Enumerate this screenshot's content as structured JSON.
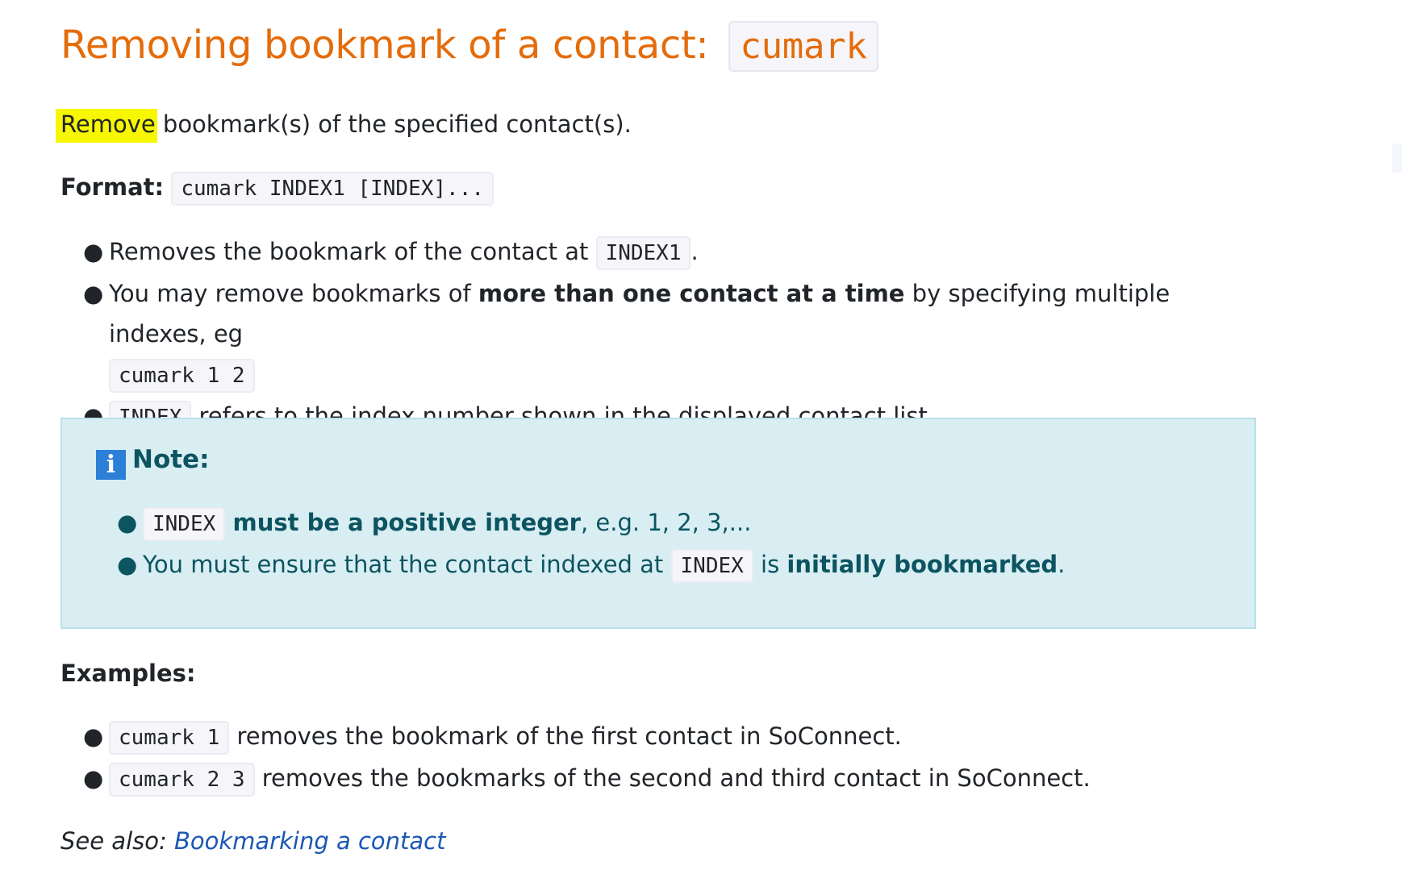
{
  "title": {
    "text": "Removing bookmark of a contact:",
    "command": "cumark"
  },
  "intro": {
    "highlighted": "Remove",
    "rest": " bookmark(s) of the specified contact(s)."
  },
  "format": {
    "label": "Format:",
    "code": "cumark INDEX1 [INDEX]..."
  },
  "usage": [
    {
      "before": "Removes the bookmark of the contact at ",
      "code": "INDEX1",
      "after": "."
    },
    {
      "before": "You may remove bookmarks of ",
      "bold": "more than one contact at a time",
      "after": " by specifying multiple indexes, eg",
      "code": "cumark 1 2"
    },
    {
      "code": "INDEX",
      "after": " refers to the index number shown in the displayed contact list."
    }
  ],
  "note": {
    "title": "Note:",
    "items": [
      {
        "code": "INDEX",
        "bold": "must be a positive integer",
        "after": ", e.g. 1, 2, 3,..."
      },
      {
        "before": "You must ensure that the contact indexed at ",
        "code": "INDEX",
        "middle": " is ",
        "bold": "initially bookmarked",
        "after": "."
      }
    ]
  },
  "examples": {
    "title": "Examples:",
    "items": [
      {
        "code": "cumark 1",
        "text": " removes the bookmark of the first contact in SoConnect."
      },
      {
        "code": "cumark 2 3",
        "text": " removes the bookmarks of the second and third contact in SoConnect."
      }
    ]
  },
  "see_also": {
    "label": "See also: ",
    "link": "Bookmarking a contact"
  },
  "colors": {
    "title": "#e46c0a",
    "highlight": "#f6f700",
    "note_bg": "#d8eef3",
    "note_text": "#0c5460",
    "link": "#1b57b5",
    "info_icon": "#2b7fd6"
  },
  "icons": {
    "note": "info-icon"
  }
}
